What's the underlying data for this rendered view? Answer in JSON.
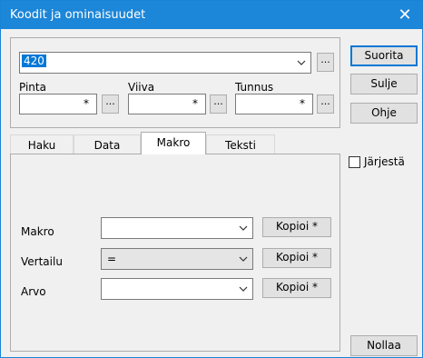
{
  "window": {
    "title": "Koodit ja ominaisuudet",
    "close_label": "✕"
  },
  "main_combo": {
    "value": "420",
    "more_label": "..."
  },
  "fields": {
    "pinta": {
      "label": "Pinta",
      "value": "*",
      "more_label": "..."
    },
    "viiva": {
      "label": "Viiva",
      "value": "*",
      "more_label": "..."
    },
    "tunnus": {
      "label": "Tunnus",
      "value": "*",
      "more_label": "..."
    }
  },
  "buttons": {
    "suorita": "Suorita",
    "sulje": "Sulje",
    "ohje": "Ohje",
    "nollaa": "Nollaa"
  },
  "tabs": [
    {
      "label": "Haku"
    },
    {
      "label": "Data"
    },
    {
      "label": "Makro"
    },
    {
      "label": "Teksti"
    }
  ],
  "sort_checkbox": {
    "label": "Järjestä",
    "checked": false
  },
  "makro_tab": {
    "rows": [
      {
        "label": "Makro",
        "value": "",
        "button": "Kopioi *"
      },
      {
        "label": "Vertailu",
        "value": "=",
        "button": "Kopioi *"
      },
      {
        "label": "Arvo",
        "value": "",
        "button": "Kopioi *"
      }
    ]
  },
  "colors": {
    "titlebar": "#1c86d8",
    "accent": "#0078d7"
  }
}
